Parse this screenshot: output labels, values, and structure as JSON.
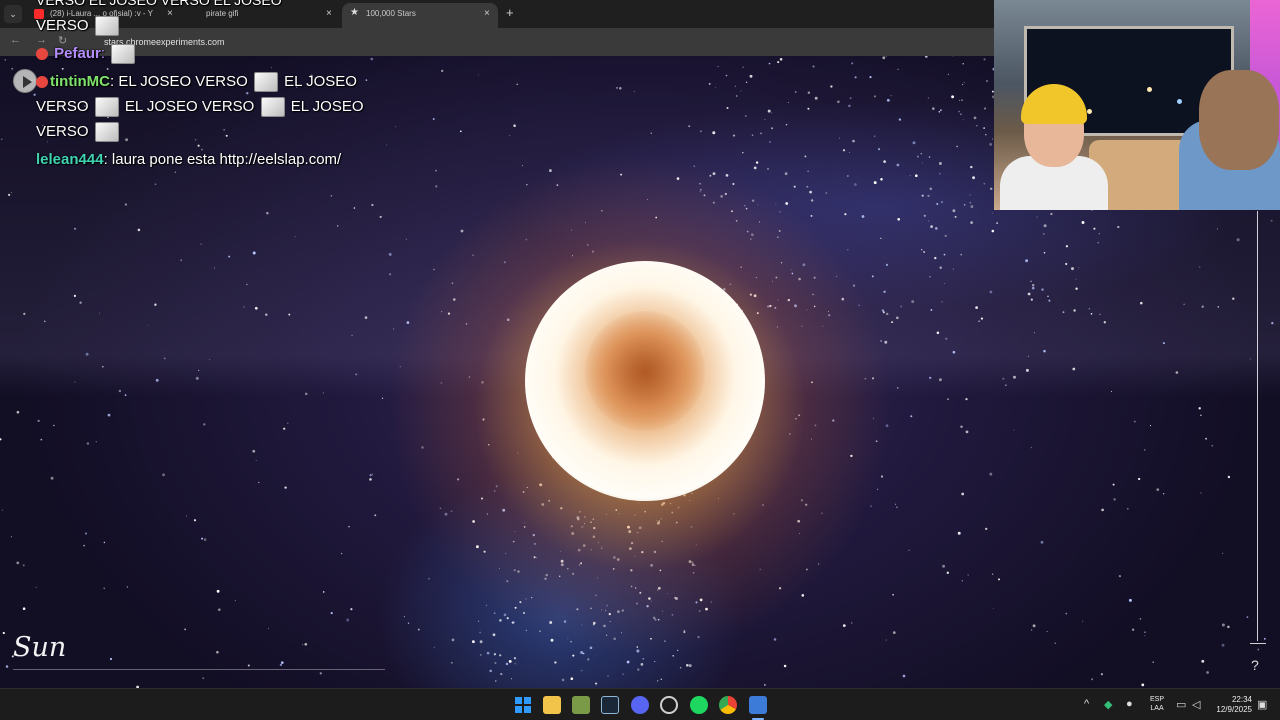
{
  "browser": {
    "tabs": [
      {
        "title": "(28) i-Laura ... o ofisial) :v - Y",
        "active": false,
        "favicon_color": "#ff2a2a"
      },
      {
        "title": "pirate gifi",
        "active": false,
        "favicon_color": "#8a8a8a"
      },
      {
        "title": "100,000 Stars",
        "active": true,
        "favicon_color": "#dddddd"
      }
    ],
    "new_tab": "+",
    "close_glyph": "×",
    "url": "stars.chromeexperiments.com",
    "nav": {
      "back": "←",
      "forward": "→",
      "reload": "↻"
    }
  },
  "chat": {
    "messages": [
      {
        "user": "",
        "text": "VERSO",
        "user_color": "#ffffff"
      },
      {
        "user": "Pefaur",
        "text": "",
        "user_color": "#b48cff"
      },
      {
        "user": "tintinMC",
        "text": "EL JOSEO VERSO",
        "user_color": "#7de36b"
      },
      {
        "user": "",
        "text": "EL JOSEO",
        "user_color": "#ffffff"
      },
      {
        "user": "",
        "text": "VERSO",
        "user_color": "#ffffff"
      },
      {
        "user": "",
        "text": "EL JOSEO VERSO",
        "user_color": "#ffffff"
      },
      {
        "user": "",
        "text": "EL JOSEO",
        "user_color": "#ffffff"
      },
      {
        "user": "",
        "text": "VERSO",
        "user_color": "#ffffff"
      },
      {
        "user": "lelean444",
        "text": "laura pone esta http://eelslap.com/",
        "user_color": "#3fd3b4"
      }
    ],
    "top_partial": "VERSO EL JOSEO VERSO EL JOSEO",
    "separator": ":"
  },
  "page": {
    "star_label": "Sun",
    "help": "?"
  },
  "taskbar": {
    "language": [
      "ESP",
      "LAA"
    ],
    "time": "22:34",
    "date": "12/9/2025",
    "tray_chevron": "^",
    "icons": [
      "windows-start-icon",
      "file-explorer-icon",
      "minecraft-icon",
      "steam-icon",
      "discord-icon",
      "obs-icon",
      "spotify-icon",
      "chrome-icon",
      "capture-app-icon"
    ],
    "colors": {
      "start": "#2f9bff",
      "explorer": "#f2c44a",
      "minecraft": "#7a9a48",
      "steam": "#8fb8d8",
      "discord": "#5865f2",
      "obs": "#d0d0d0",
      "spotify": "#1ed760",
      "chrome": "#ea4335",
      "capture": "#3d7bd8"
    }
  }
}
